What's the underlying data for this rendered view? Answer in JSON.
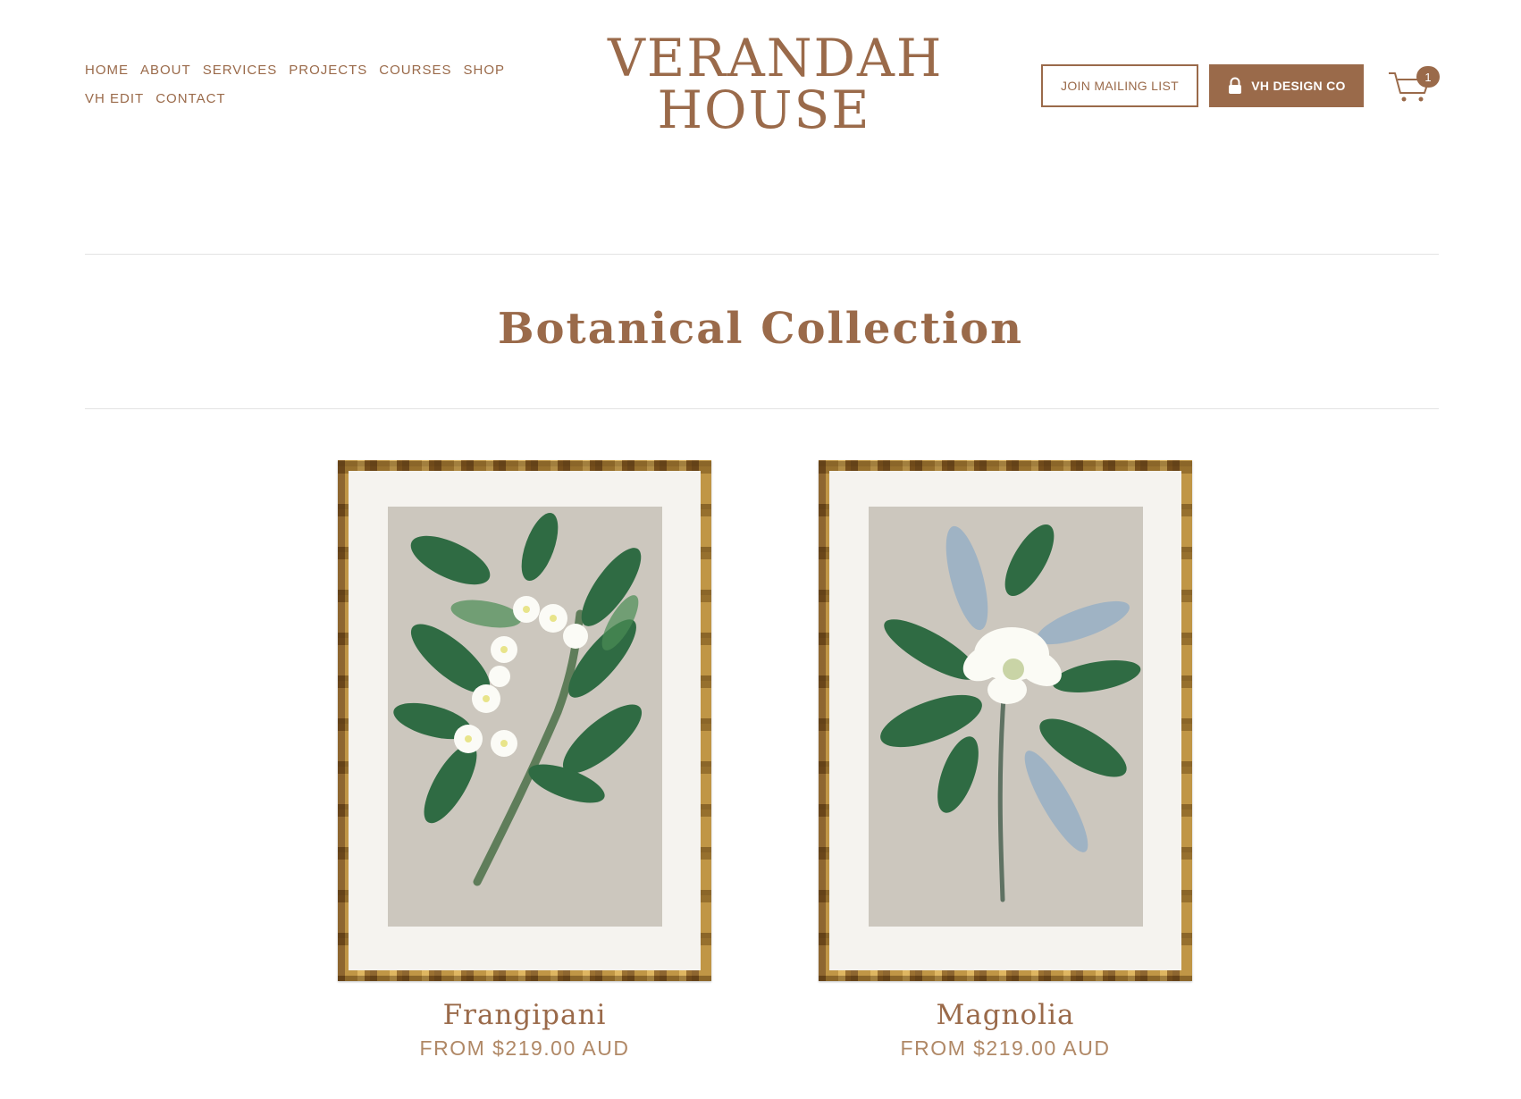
{
  "header": {
    "nav": [
      "HOME",
      "ABOUT",
      "SERVICES",
      "PROJECTS",
      "COURSES",
      "SHOP",
      "VH EDIT",
      "CONTACT"
    ],
    "logo_line1": "VERANDAH",
    "logo_line2": "HOUSE",
    "mailing_button": "JOIN MAILING LIST",
    "design_button": "VH DESIGN CO",
    "cart_count": "1"
  },
  "page": {
    "title": "Botanical Collection"
  },
  "products": [
    {
      "name": "Frangipani",
      "price": "FROM $219.00 AUD",
      "art": "frangipani-print"
    },
    {
      "name": "Magnolia",
      "price": "FROM $219.00 AUD",
      "art": "magnolia-print"
    }
  ],
  "colors": {
    "brand": "#9a6a4a",
    "divider": "#e2e2e2",
    "art_background": "#ccc7be"
  }
}
